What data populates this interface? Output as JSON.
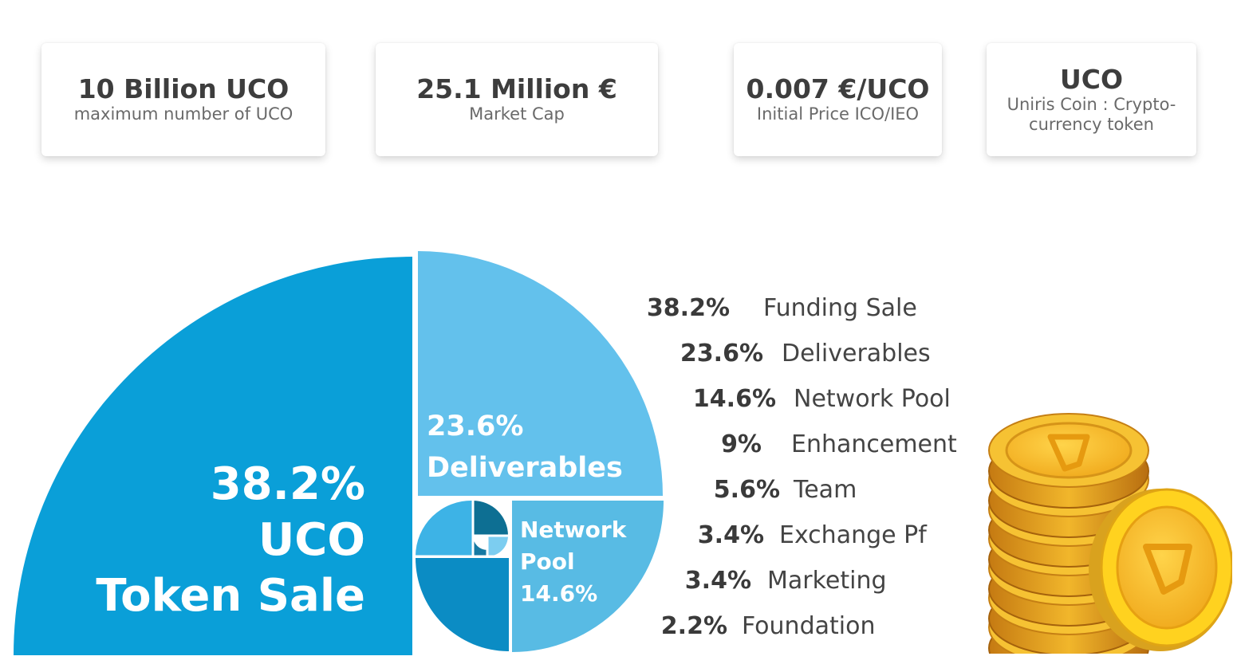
{
  "cards": [
    {
      "value": "10 Billion UCO",
      "label": "maximum number of UCO"
    },
    {
      "value": "25.1 Million €",
      "label": "Market Cap"
    },
    {
      "value": "0.007 €/UCO",
      "label": "Initial Price ICO/IEO"
    },
    {
      "value": "UCO",
      "label": "Uniris Coin : Crypto-currency token"
    }
  ],
  "chart_data": {
    "type": "pie",
    "categories": [
      "Funding Sale",
      "Deliverables",
      "Network Pool",
      "Enhancement",
      "Team",
      "Exchange Pf",
      "Marketing",
      "Foundation"
    ],
    "values": [
      38.2,
      23.6,
      14.6,
      9,
      5.6,
      3.4,
      3.4,
      2.2
    ],
    "slice_labels": [
      [
        "38.2%",
        "UCO",
        "Token Sale"
      ],
      [
        "23.6%",
        "Deliverables"
      ],
      [
        "Network",
        "Pool",
        "14.6%"
      ]
    ],
    "legend": [
      {
        "pct": "38.2%",
        "label": "Funding Sale"
      },
      {
        "pct": "23.6%",
        "label": "Deliverables"
      },
      {
        "pct": "14.6%",
        "label": "Network Pool"
      },
      {
        "pct": "9%",
        "label": "Enhancement"
      },
      {
        "pct": "5.6%",
        "label": "Team"
      },
      {
        "pct": "3.4%",
        "label": "Exchange Pf"
      },
      {
        "pct": "3.4%",
        "label": "Marketing"
      },
      {
        "pct": "2.2%",
        "label": "Foundation"
      }
    ],
    "colors": [
      "#0a9fd8",
      "#63c1ec",
      "#58bbe4",
      "#0b8cc4",
      "#3db3e6",
      "#7ccdf0",
      "#0d6f93",
      "#1679a3"
    ],
    "legend_placement": "right"
  }
}
